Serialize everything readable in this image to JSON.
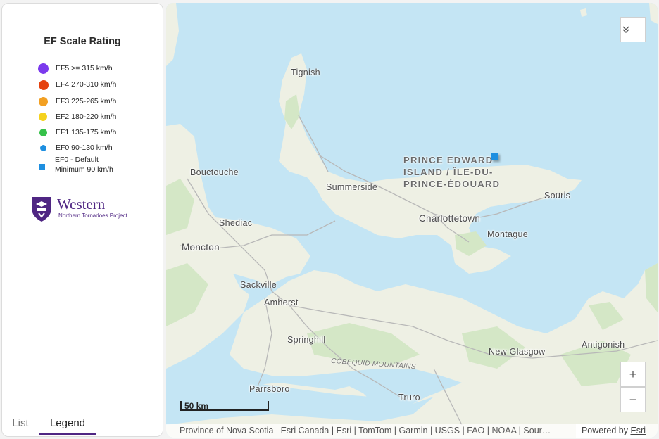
{
  "legend": {
    "title": "EF Scale Rating",
    "items": [
      {
        "label": "EF5   >= 315 km/h",
        "color": "#7b3aed",
        "shape": "circle"
      },
      {
        "label": "EF4  270-310 km/h",
        "color": "#e5420f",
        "shape": "circle"
      },
      {
        "label": "EF3  225-265 km/h",
        "color": "#f2a023",
        "shape": "circle"
      },
      {
        "label": "EF2  180-220 km/h",
        "color": "#f5d21e",
        "shape": "circle"
      },
      {
        "label": "EF1  135-175 km/h",
        "color": "#36c14a",
        "shape": "circle"
      },
      {
        "label": "EF0  90-130 km/h",
        "color": "#1e8fe0",
        "shape": "circle"
      },
      {
        "label_line1": "EF0 - Default",
        "label_line2": "Minimum 90 km/h",
        "color": "#1e8fe0",
        "shape": "square"
      }
    ]
  },
  "logo": {
    "name": "Western",
    "subtitle": "Northern Tornadoes Project",
    "color": "#4f2683"
  },
  "tabs": {
    "list": "List",
    "legend": "Legend",
    "active": "Legend"
  },
  "map": {
    "labels": {
      "tignish": "Tignish",
      "bouctouche": "Bouctouche",
      "summerside": "Summerside",
      "souris": "Souris",
      "charlottetown": "Charlottetown",
      "montague": "Montague",
      "shediac": "Shediac",
      "moncton": "Moncton",
      "sackville": "Sackville",
      "amherst": "Amherst",
      "springhill": "Springhill",
      "new_glasgow": "New Glasgow",
      "antigonish": "Antigonish",
      "parrsboro": "Parrsboro",
      "truro": "Truro",
      "cobequid": "COBEQUID MOUNTAINS"
    },
    "province": {
      "line1": "PRINCE EDWARD",
      "line2": "ISLAND / ÎLE-DU-",
      "line3": "PRINCE-ÉDOUARD"
    },
    "collapse_icon": "chevrons-down-icon",
    "zoom_in": "+",
    "zoom_out": "−",
    "scale_label": "50 km",
    "attribution": "Province of Nova Scotia | Esri Canada | Esri | TomTom | Garmin | USGS | FAO | NOAA | Sour…",
    "powered_by": "Powered by",
    "esri_link": "Esri",
    "colors": {
      "water": "#c4e5f4",
      "land": "#eef0e4",
      "forest": "#d4e7c6",
      "roads": "#b8b8b8"
    }
  }
}
